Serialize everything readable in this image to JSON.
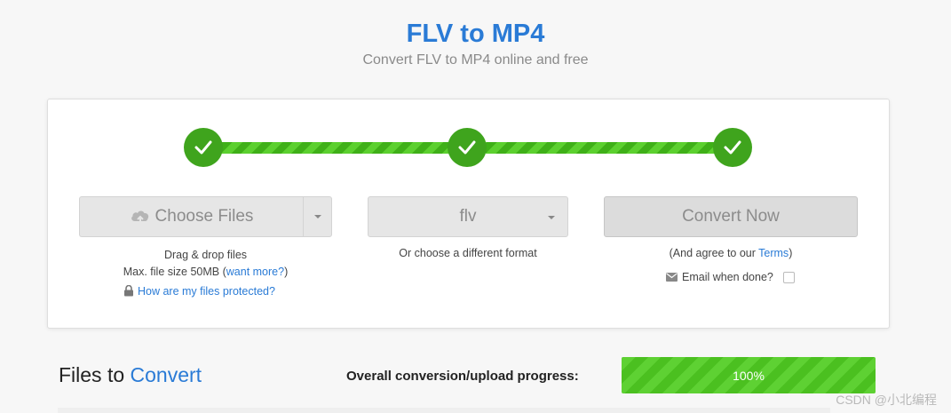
{
  "header": {
    "title": "FLV to MP4",
    "subtitle": "Convert FLV to MP4 online and free"
  },
  "steps": [
    {
      "state": "complete",
      "icon": "checkmark-icon"
    },
    {
      "state": "complete",
      "icon": "checkmark-icon"
    },
    {
      "state": "complete",
      "icon": "checkmark-icon"
    }
  ],
  "upload": {
    "button_label": "Choose Files",
    "icon": "cloud-upload-icon",
    "hint_line1": "Drag & drop files",
    "hint_line2_prefix": "Max. file size 50MB (",
    "want_more_link": "want more?",
    "hint_line2_suffix": ")",
    "protected_link": "How are my files protected?",
    "protected_icon": "lock-icon"
  },
  "format": {
    "selected": "flv",
    "hint": "Or choose a different format"
  },
  "convert": {
    "button_label": "Convert Now",
    "agree_prefix": "(And agree to our ",
    "terms_link": "Terms",
    "agree_suffix": ")",
    "email_label": "Email when done?",
    "email_icon": "envelope-icon",
    "email_checked": false
  },
  "files_section": {
    "title_part1": "Files to",
    "title_part2": "Convert",
    "progress_label": "Overall conversion/upload progress:",
    "progress_value": 100,
    "progress_text": "100%"
  },
  "watermark": "CSDN @小北编程",
  "colors": {
    "accent": "#2a7bd6",
    "success": "#3fa41d",
    "progress": "#4bc020"
  }
}
